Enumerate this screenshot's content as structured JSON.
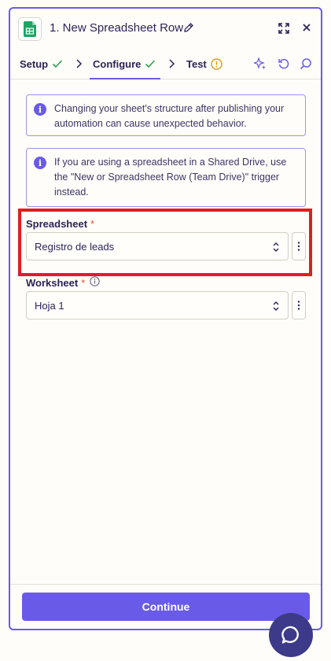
{
  "header": {
    "title": "1. New Spreadsheet Row",
    "app_icon": "google-sheets-icon"
  },
  "tabs": [
    {
      "label": "Setup",
      "status": "complete"
    },
    {
      "label": "Configure",
      "status": "complete",
      "active": true
    },
    {
      "label": "Test",
      "status": "warning"
    }
  ],
  "toolbar_icons": [
    "sparkle-icon",
    "refresh-icon",
    "search-icon"
  ],
  "alerts": [
    "Changing your sheet's structure after publishing your automation can cause unexpected behavior.",
    "If you are using a spreadsheet in a Shared Drive, use the \"New or Spreadsheet Row (Team Drive)\" trigger instead."
  ],
  "fields": {
    "spreadsheet": {
      "label": "Spreadsheet",
      "required_mark": "*",
      "value": "Registro de leads"
    },
    "worksheet": {
      "label": "Worksheet",
      "required_mark": "*",
      "value": "Hoja 1"
    }
  },
  "footer": {
    "continue_label": "Continue"
  },
  "colors": {
    "accent": "#695be8",
    "required": "#e8532d",
    "success": "#2ba34b",
    "warning": "#d4a017",
    "highlight": "#e01e1e",
    "chat": "#3d3a8a"
  }
}
